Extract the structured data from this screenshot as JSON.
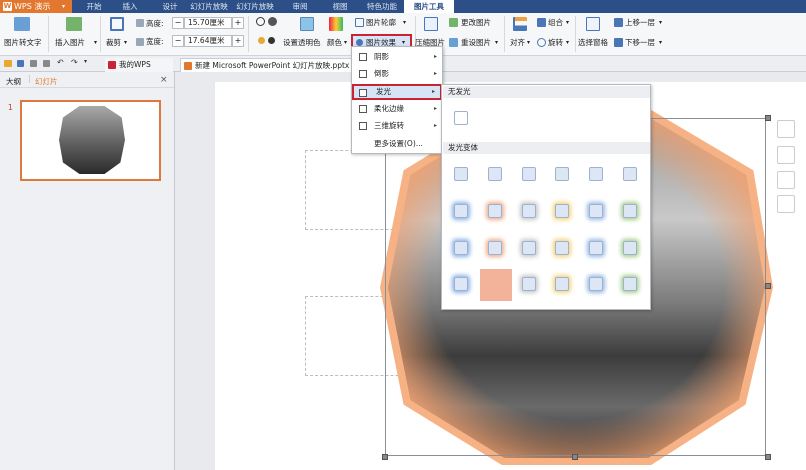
{
  "app": {
    "name": "WPS 演示",
    "logo": "W"
  },
  "menu_tabs": [
    "开始",
    "插入",
    "设计",
    "幻灯片放映",
    "审阅",
    "视图",
    "特色功能",
    "图片工具"
  ],
  "active_tab": "图片工具",
  "ribbon": {
    "picture_to_text": "图片转文字",
    "insert_picture": "插入图片",
    "crop": "裁剪",
    "height_label": "高度:",
    "height_value": "15.70厘米",
    "width_label": "宽度:",
    "width_value": "17.64厘米",
    "minus": "−",
    "plus": "+",
    "set_transparent": "设置透明色",
    "color": "颜色",
    "picture_outline": "图片轮廓",
    "picture_effects": "图片效果",
    "compress_picture": "压缩图片",
    "change_picture": "更改图片",
    "reset_picture": "重设图片",
    "align": "对齐",
    "group": "组合",
    "rotate": "旋转",
    "selection_pane": "选择窗格",
    "bring_forward": "上移一层",
    "send_backward": "下移一层"
  },
  "quickbar": {
    "my_wps": "我的WPS",
    "document_tab": "新建 Microsoft PowerPoint 幻灯片放映.pptx"
  },
  "left_panel": {
    "tab_outline": "大纲",
    "tab_slides": "幻灯片",
    "slide_number": "1",
    "close": "×"
  },
  "effects_menu": {
    "items": [
      "阴影",
      "倒影",
      "发光",
      "柔化边缘",
      "三维旋转",
      "更多设置(O)..."
    ]
  },
  "glow_submenu": {
    "no_glow": "无发光",
    "variants_header": "发光变体",
    "rows": [
      [
        "#ffffff",
        "#ffffff",
        "#ffffff",
        "#ffffff",
        "#ffffff",
        "#ffffff"
      ],
      [
        "#8fb4e8",
        "#f0b090",
        "#c9c9c9",
        "#f5d57a",
        "#9bbce6",
        "#a7d08c"
      ],
      [
        "#8fb4e8",
        "#f0b090",
        "#c9c9c9",
        "#f5d57a",
        "#9bbce6",
        "#a7d08c"
      ],
      [
        "#8fb4e8",
        "#f0b090",
        "#c9c9c9",
        "#f5d57a",
        "#9bbce6",
        "#a7d08c"
      ]
    ],
    "selected": "row4-col2"
  },
  "colors": {
    "accent": "#2b4f86",
    "app_orange": "#e2782f",
    "highlight_red": "#c82434",
    "glow_orange": "#f1a06e"
  }
}
